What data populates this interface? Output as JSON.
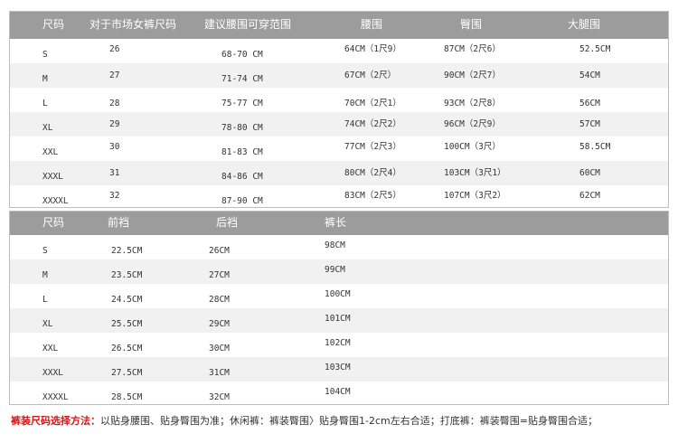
{
  "table1": {
    "headers": [
      "尺码",
      "对于市场女裤尺码",
      "建议腰围可穿范围",
      "腰围",
      "臀围",
      "大腿围"
    ],
    "rows": [
      [
        "S",
        "26",
        "68-70 CM",
        "64CM（1尺9）",
        "87CM（2尺6）",
        "52.5CM"
      ],
      [
        "M",
        "27",
        "71-74 CM",
        "67CM（2尺）",
        "90CM（2尺7）",
        "54CM"
      ],
      [
        "L",
        "28",
        "75-77 CM",
        "70CM（2尺1）",
        "93CM（2尺8）",
        "56CM"
      ],
      [
        "XL",
        "29",
        "78-80 CM",
        "74CM（2尺2）",
        "96CM（2尺9）",
        "57CM"
      ],
      [
        "XXL",
        "30",
        "81-83 CM",
        "77CM（2尺3）",
        "100CM（3尺）",
        "58.5CM"
      ],
      [
        "XXXL",
        "31",
        "84-86 CM",
        "80CM（2尺4）",
        "103CM（3尺1）",
        "60CM"
      ],
      [
        "XXXXL",
        "32",
        "87-90 CM",
        "83CM（2尺5）",
        "107CM（3尺2）",
        "62CM"
      ]
    ]
  },
  "table2": {
    "headers": [
      "尺码",
      "前裆",
      "后裆",
      "裤长"
    ],
    "rows": [
      [
        "S",
        "22.5CM",
        "26CM",
        "98CM"
      ],
      [
        "M",
        "23.5CM",
        "27CM",
        "99CM"
      ],
      [
        "L",
        "24.5CM",
        "28CM",
        "100CM"
      ],
      [
        "XL",
        "25.5CM",
        "29CM",
        "101CM"
      ],
      [
        "XXL",
        "26.5CM",
        "30CM",
        "102CM"
      ],
      [
        "XXXL",
        "27.5CM",
        "31CM",
        "103CM"
      ],
      [
        "XXXXL",
        "28.5CM",
        "32CM",
        "104CM"
      ]
    ]
  },
  "note": {
    "label": "裤装尺码选择方法：",
    "text": "以贴身腰围、贴身臀围为准；休闲裤：裤装臀围〉贴身臀围1-2cm左右合适；打底裤：裤装臀围=贴身臀围合适；"
  }
}
